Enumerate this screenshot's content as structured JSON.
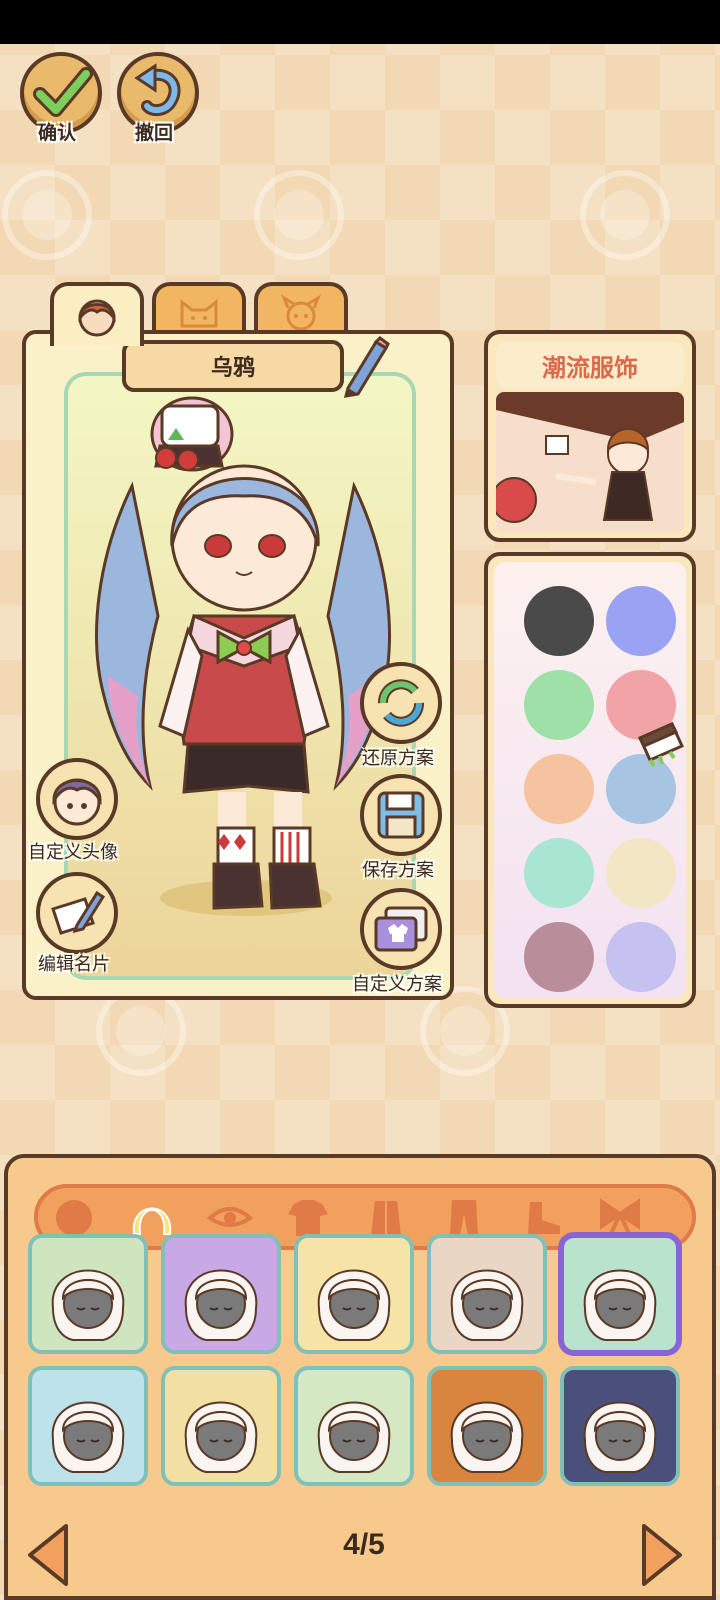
{
  "top_bar": {
    "confirm_label": "确认",
    "undo_label": "撤回"
  },
  "character": {
    "name": "乌鸦",
    "tabs": [
      "girl-face-icon",
      "cat-face-icon",
      "dog-face-icon"
    ],
    "actions": {
      "restore_label": "还原方案",
      "save_label": "保存方案",
      "custom_scheme_label": "自定义方案",
      "custom_avatar_label": "自定义头像",
      "edit_card_label": "编辑名片"
    }
  },
  "trend": {
    "title": "潮流服饰"
  },
  "colors": {
    "swatches": [
      "#4a4a4a",
      "#9aa3f3",
      "#9ee0a8",
      "#f2a3a8",
      "#f5c3a0",
      "#a8c4e3",
      "#a9e6d2",
      "#f3e6c4",
      "#b98d99",
      "#c5c2f0"
    ]
  },
  "categories": [
    "face-icon",
    "hair-icon",
    "eye-icon",
    "shirt-icon",
    "coat-icon",
    "pants-icon",
    "shoe-icon",
    "bow-icon"
  ],
  "active_category": "hair-icon",
  "items": [
    {
      "bg": "#cfe5c0",
      "hair": "short-wavy"
    },
    {
      "bg": "#c9a8e6",
      "hair": "twin-tails"
    },
    {
      "bg": "#f6e3a8",
      "hair": "spiky"
    },
    {
      "bg": "#e9d6c4",
      "hair": "bun"
    },
    {
      "bg": "#b9e3cc",
      "hair": "drill-tails",
      "selected": true
    },
    {
      "bg": "#bde2ea",
      "hair": "braided"
    },
    {
      "bg": "#f1dfa3",
      "hair": "long-straight"
    },
    {
      "bg": "#d5e8c4",
      "hair": "messy-long"
    },
    {
      "bg": "#d9843f",
      "hair": "fluffy"
    },
    {
      "bg": "#4a4f7c",
      "hair": "curly-bob"
    }
  ],
  "pagination": {
    "label": "4/5"
  }
}
